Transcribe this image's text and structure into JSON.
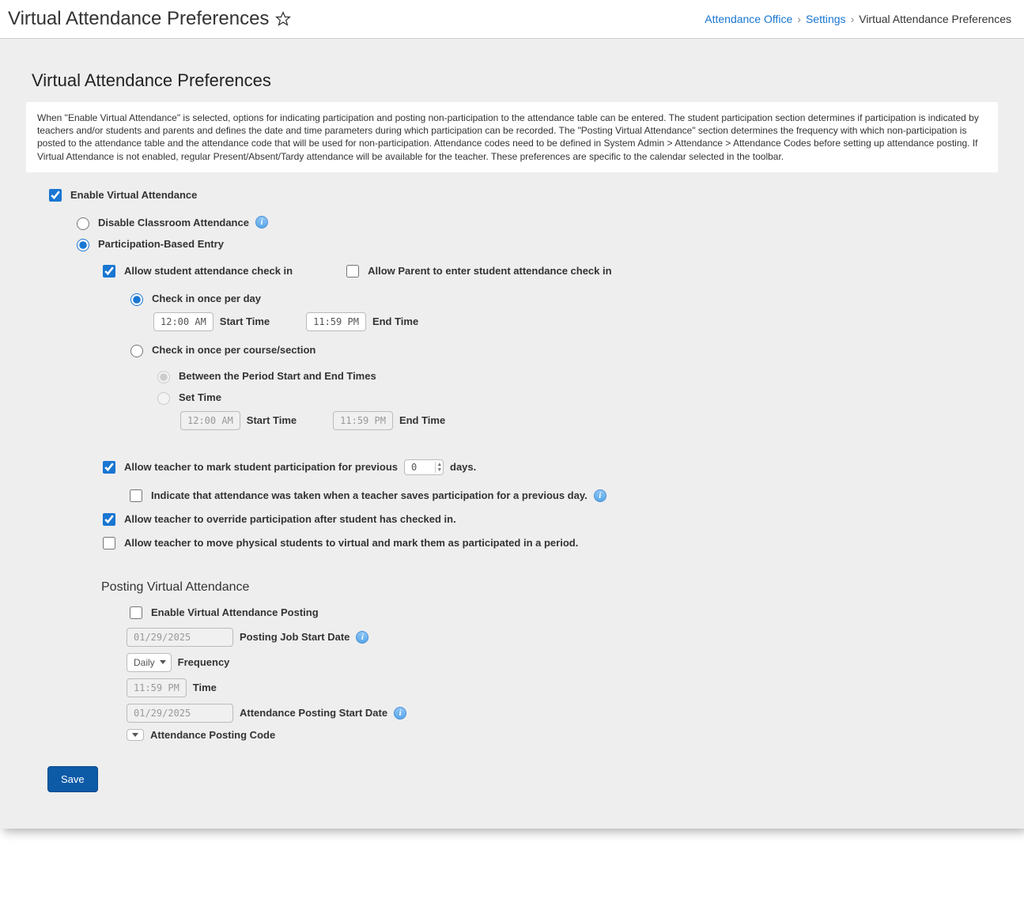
{
  "header": {
    "title": "Virtual Attendance Preferences",
    "breadcrumb": {
      "items": [
        "Attendance Office",
        "Settings",
        "Virtual Attendance Preferences"
      ]
    }
  },
  "panel": {
    "title": "Virtual Attendance Preferences",
    "description": "When \"Enable Virtual Attendance\" is selected, options for indicating participation and posting non-participation to the attendance table can be entered. The student participation section determines if participation is indicated by teachers and/or students and parents and defines the date and time parameters during which participation can be recorded. The \"Posting Virtual Attendance\" section determines the frequency with which non-participation is posted to the attendance table and the attendance code that will be used for non-participation. Attendance codes need to be defined in System Admin > Attendance > Attendance Codes before setting up attendance posting. If Virtual Attendance is not enabled, regular Present/Absent/Tardy attendance will be available for the teacher. These preferences are specific to the calendar selected in the toolbar."
  },
  "controls": {
    "enable_virtual": "Enable Virtual Attendance",
    "disable_classroom": "Disable Classroom Attendance",
    "participation_based": "Participation-Based Entry",
    "allow_student_checkin": "Allow student attendance check in",
    "allow_parent_checkin": "Allow Parent to enter student attendance check in",
    "checkin_once_day": "Check in once per day",
    "start_time_label": "Start Time",
    "end_time_label": "End Time",
    "checkin_once_course": "Check in once per course/section",
    "between_period": "Between the Period Start and End Times",
    "set_time": "Set Time",
    "allow_teacher_mark_prev_pre": "Allow teacher to mark student participation for previous",
    "allow_teacher_mark_prev_post": "days.",
    "indicate_taken": "Indicate that attendance was taken when a teacher saves participation for a previous day.",
    "allow_override": "Allow teacher to override participation after student has checked in.",
    "allow_move": "Allow teacher to move physical students to virtual and mark them as participated in a period.",
    "prev_days_value": "0"
  },
  "times": {
    "day_start": "12:00 AM",
    "day_end": "11:59 PM",
    "set_start": "12:00 AM",
    "set_end": "11:59 PM"
  },
  "posting": {
    "heading": "Posting Virtual Attendance",
    "enable_posting": "Enable Virtual Attendance Posting",
    "job_start_date_label": "Posting Job Start Date",
    "job_start_date": "01/29/2025",
    "frequency_label": "Frequency",
    "frequency_value": "Daily",
    "time_label": "Time",
    "time_value": "11:59 PM",
    "posting_start_label": "Attendance Posting Start Date",
    "posting_start_date": "01/29/2025",
    "posting_code_label": "Attendance Posting Code"
  },
  "buttons": {
    "save": "Save"
  }
}
